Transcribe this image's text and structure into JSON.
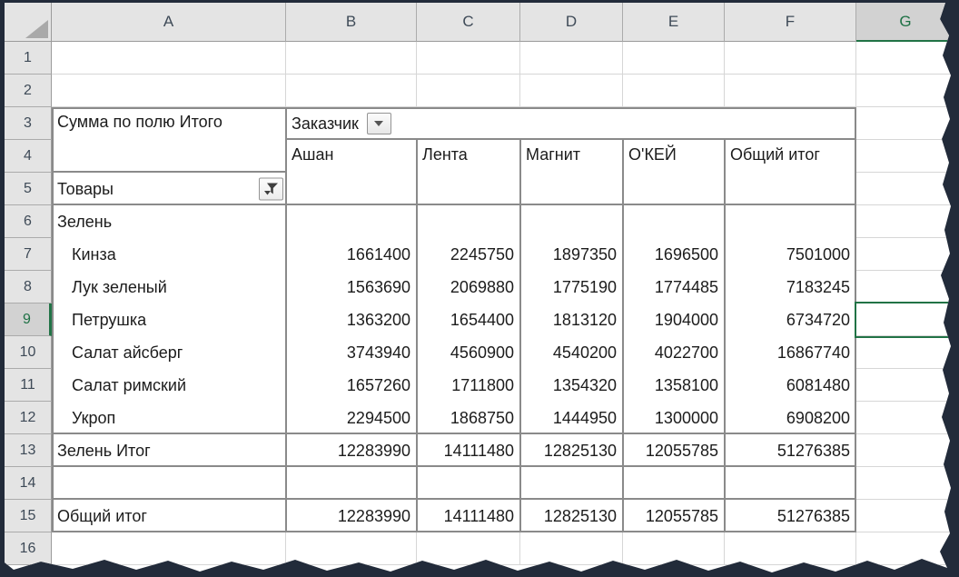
{
  "grid": {
    "column_headers": [
      "A",
      "B",
      "C",
      "D",
      "E",
      "F",
      "G"
    ],
    "row_headers": [
      "1",
      "2",
      "3",
      "4",
      "5",
      "6",
      "7",
      "8",
      "9",
      "10",
      "11",
      "12",
      "13",
      "14",
      "15",
      "16"
    ],
    "active_cell": {
      "column": "G",
      "row": "9"
    }
  },
  "pivot_table": {
    "value_field_label": "Сумма по полю Итого",
    "column_field": {
      "label": "Заказчик"
    },
    "row_field": {
      "label": "Товары"
    },
    "column_headers": [
      "Ашан",
      "Лента",
      "Магнит",
      "О'КЕЙ",
      "Общий итог"
    ],
    "group_label": "Зелень",
    "items": [
      {
        "label": "Кинза",
        "values": [
          1661400,
          2245750,
          1897350,
          1696500,
          7501000
        ]
      },
      {
        "label": "Лук зеленый",
        "values": [
          1563690,
          2069880,
          1775190,
          1774485,
          7183245
        ]
      },
      {
        "label": "Петрушка",
        "values": [
          1363200,
          1654400,
          1813120,
          1904000,
          6734720
        ]
      },
      {
        "label": "Салат айсберг",
        "values": [
          3743940,
          4560900,
          4540200,
          4022700,
          16867740
        ]
      },
      {
        "label": "Салат римский",
        "values": [
          1657260,
          1711800,
          1354320,
          1358100,
          6081480
        ]
      },
      {
        "label": "Укроп",
        "values": [
          2294500,
          1868750,
          1444950,
          1300000,
          6908200
        ]
      }
    ],
    "group_total": {
      "label": "Зелень Итог",
      "values": [
        12283990,
        14111480,
        12825130,
        12055785,
        51276385
      ]
    },
    "grand_total": {
      "label": "Общий итог",
      "values": [
        12283990,
        14111480,
        12825130,
        12055785,
        51276385
      ]
    }
  },
  "icons": {
    "column_field_dropdown": "chevron-down-icon",
    "row_field_filter": "filter-funnel-icon",
    "select_all": "select-all-triangle-icon"
  },
  "colors": {
    "accent_green": "#217346",
    "header_background": "#E4E4E4",
    "selected_header_background": "#D2D2D2",
    "header_text": "#3E4A57",
    "gridline": "#D6D6D6",
    "pivot_border": "#8A8A8A",
    "cell_text": "#1C1C1C",
    "frame_background": "#222B3A"
  }
}
